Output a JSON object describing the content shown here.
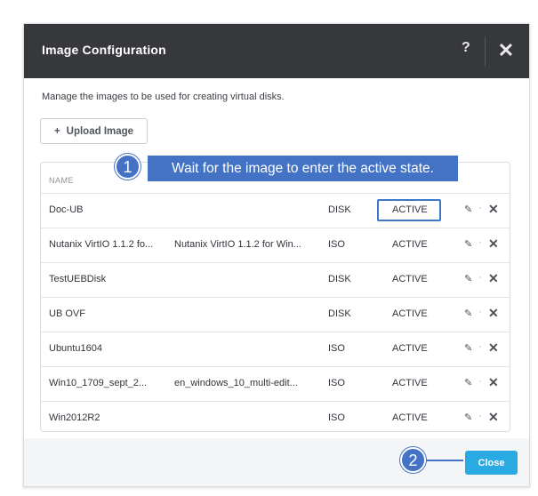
{
  "dialog": {
    "title": "Image Configuration",
    "help_icon": "?",
    "close_icon": "✕"
  },
  "description": "Manage the images to be used for creating virtual disks.",
  "upload_button": {
    "icon": "+",
    "label": "Upload Image"
  },
  "table": {
    "header_name": "NAME",
    "rows": [
      {
        "name": "Doc-UB",
        "annotation": "",
        "type": "DISK",
        "state": "ACTIVE"
      },
      {
        "name": "Nutanix VirtIO 1.1.2 fo...",
        "annotation": "Nutanix VirtIO 1.1.2 for Win...",
        "type": "ISO",
        "state": "ACTIVE"
      },
      {
        "name": "TestUEBDisk",
        "annotation": "",
        "type": "DISK",
        "state": "ACTIVE"
      },
      {
        "name": "UB OVF",
        "annotation": "",
        "type": "DISK",
        "state": "ACTIVE"
      },
      {
        "name": "Ubuntu1604",
        "annotation": "",
        "type": "ISO",
        "state": "ACTIVE"
      },
      {
        "name": "Win10_1709_sept_2...",
        "annotation": "en_windows_10_multi-edit...",
        "type": "ISO",
        "state": "ACTIVE"
      },
      {
        "name": "Win2012R2",
        "annotation": "",
        "type": "ISO",
        "state": "ACTIVE"
      }
    ],
    "action_edit_icon": "✎",
    "action_separator": "·",
    "action_delete_icon": "✕"
  },
  "footer": {
    "close_label": "Close"
  },
  "callouts": {
    "step1_number": "1",
    "step1_text": "Wait for the image to enter the active state.",
    "step2_number": "2"
  },
  "colors": {
    "titlebar": "#36383c",
    "callout": "#4473c5",
    "close_button": "#2aaae2"
  }
}
